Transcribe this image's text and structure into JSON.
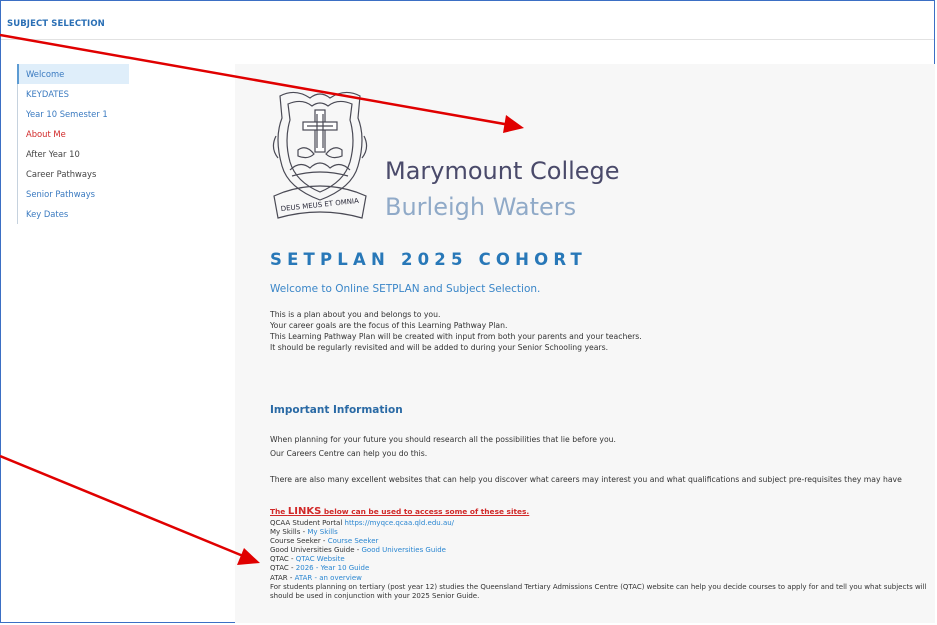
{
  "header": {
    "title": "SUBJECT SELECTION"
  },
  "sidebar": {
    "items": [
      {
        "label": "Welcome"
      },
      {
        "label": "KEYDATES"
      },
      {
        "label": "Year 10 Semester 1"
      },
      {
        "label": "About Me"
      },
      {
        "label": "After Year 10"
      },
      {
        "label": "Career Pathways"
      },
      {
        "label": "Senior Pathways"
      },
      {
        "label": "Key Dates"
      }
    ]
  },
  "colors": {
    "accent": "#2878b8",
    "link": "#2a86d1",
    "alert": "#d12828",
    "arrow": "#e00000"
  },
  "logo": {
    "motto": "DEUS MEUS ET OMNIA"
  },
  "college": {
    "name": "Marymount College",
    "location": "Burleigh Waters"
  },
  "main": {
    "heading": "SETPLAN 2025 COHORT",
    "welcome": "Welcome to Online SETPLAN and Subject Selection.",
    "intro": [
      "This is a plan about you and belongs to you.",
      "Your career goals are the focus of this Learning Pathway Plan.",
      "This Learning Pathway Plan will be created with input from both your parents and your teachers.",
      "It should be regularly revisited and will be added to during your Senior Schooling years."
    ],
    "important_heading": "Important Information",
    "important_lines": [
      "When planning for your future you should research all the possibilities that lie before you.",
      "Our Careers Centre can help you do this."
    ],
    "websites_line": "There are also many excellent websites that can help you discover what careers may interest you and what qualifications and subject pre-requisites they may have",
    "links_heading_pre": "The ",
    "links_heading_big": "LINKS",
    "links_heading_post": " below can be used to access some of these sites.",
    "links": [
      {
        "prefix": "QCAA Student Portal  ",
        "link": "https://myqce.qcaa.qld.edu.au/"
      },
      {
        "prefix": "My Skills - ",
        "link": "My Skills"
      },
      {
        "prefix": "Course Seeker - ",
        "link": "Course Seeker"
      },
      {
        "prefix": "Good Universities Guide - ",
        "link": "Good Universities Guide"
      },
      {
        "prefix": "QTAC - ",
        "link": "QTAC Website"
      },
      {
        "prefix": "QTAC - ",
        "link": "2026 - Year 10 Guide"
      },
      {
        "prefix": "ATAR - ",
        "link": "ATAR - an overview"
      }
    ],
    "footer_lines": [
      "For students planning on tertiary (post year 12) studies the Queensland Tertiary Admissions Centre (QTAC) website can help you decide courses to apply for and tell you what subjects will",
      "should be used in conjunction with your 2025 Senior Guide."
    ]
  }
}
